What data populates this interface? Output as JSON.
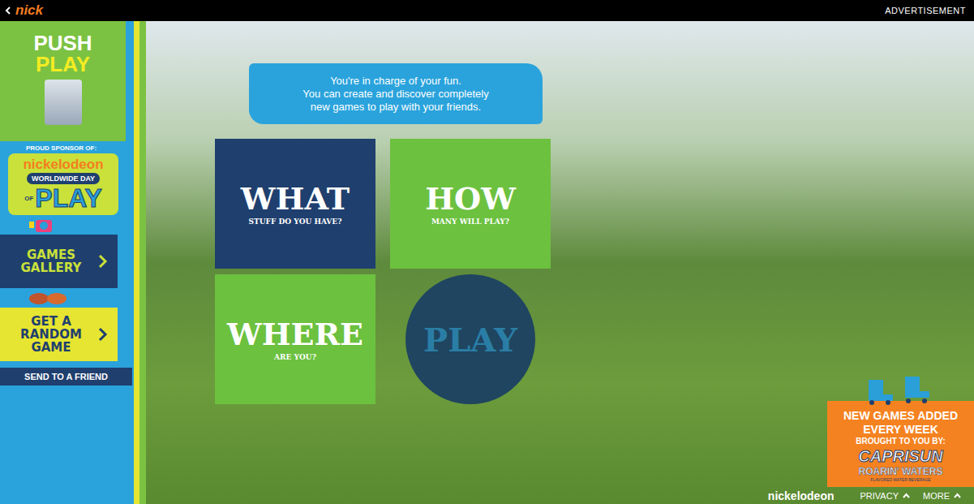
{
  "top_bar": {
    "logo": "nick",
    "label": "ADVERTISEMENT"
  },
  "sidebar": {
    "title_top": "PUSH",
    "title_bottom": "PLAY",
    "sponsor_label": "PROUD SPONSOR OF:",
    "badge": {
      "brand": "nickelodeon",
      "line": "WORLDWIDE DAY",
      "of": "OF",
      "big": "PLAY"
    },
    "links": [
      {
        "label": "GAMES GALLERY",
        "kind": "gallery"
      },
      {
        "label": "GET A RANDOM GAME",
        "kind": "random"
      }
    ],
    "send": "SEND TO A FRIEND"
  },
  "intro": [
    "You're in charge of your fun.",
    "You can create and discover completely",
    "new games to play with your friends."
  ],
  "tiles": [
    {
      "title": "WHAT",
      "subtitle": "STUFF DO YOU HAVE?",
      "color": "#1f3f6e"
    },
    {
      "title": "HOW",
      "subtitle": "MANY WILL PLAY?",
      "color": "#6cc13f"
    },
    {
      "title": "WHERE",
      "subtitle": "ARE YOU?",
      "color": "#6cc13f"
    }
  ],
  "play": {
    "label": "PLAY"
  },
  "promo": {
    "lines": [
      "NEW GAMES ADDED",
      "EVERY WEEK",
      "BROUGHT TO YOU BY:"
    ],
    "brand": "CAPRISUN",
    "sub": "ROARIN' WATERS",
    "tiny": "FLAVORED WATER BEVERAGE"
  },
  "footer": {
    "logo": "nickelodeon",
    "links": [
      "PRIVACY",
      "MORE"
    ]
  }
}
